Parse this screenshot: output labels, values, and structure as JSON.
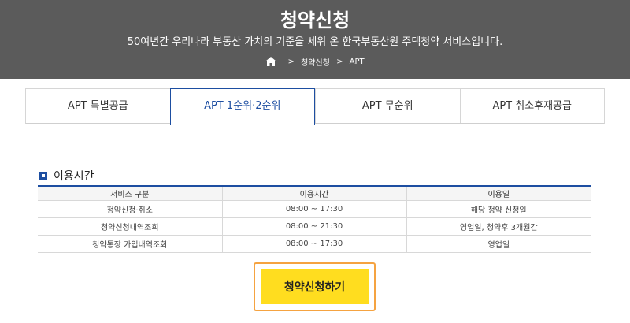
{
  "header": {
    "title": "청약신청",
    "subtitle": "50여년간 우리나라 부동산 가치의 기준을 세워 온 한국부동산원 주택청약 서비스입니다.",
    "breadcrumb": [
      "청약신청",
      "APT"
    ]
  },
  "tabs": [
    {
      "label": "APT 특별공급",
      "active": false
    },
    {
      "label": "APT 1순위·2순위",
      "active": true
    },
    {
      "label": "APT 무순위",
      "active": false
    },
    {
      "label": "APT 취소후재공급",
      "active": false
    }
  ],
  "section": {
    "title": "이용시간"
  },
  "table": {
    "headers": [
      "서비스 구분",
      "이용시간",
      "이용일"
    ],
    "rows": [
      [
        "청약신청·취소",
        "08:00 ~ 17:30",
        "해당 청약 신청일"
      ],
      [
        "청약신청내역조회",
        "08:00 ~ 21:30",
        "영업일, 청약후 3개월간"
      ],
      [
        "청약통장 가입내역조회",
        "08:00 ~ 17:30",
        "영업일"
      ]
    ]
  },
  "cta": {
    "label": "청약신청하기"
  },
  "colors": {
    "accent": "#1d4ea1",
    "cta": "#ffdd1f",
    "cta_outline": "#f5a341",
    "hero": "#5b5b5b"
  },
  "icons": {
    "home": "home-icon",
    "separator": "chevron-right-icon"
  }
}
